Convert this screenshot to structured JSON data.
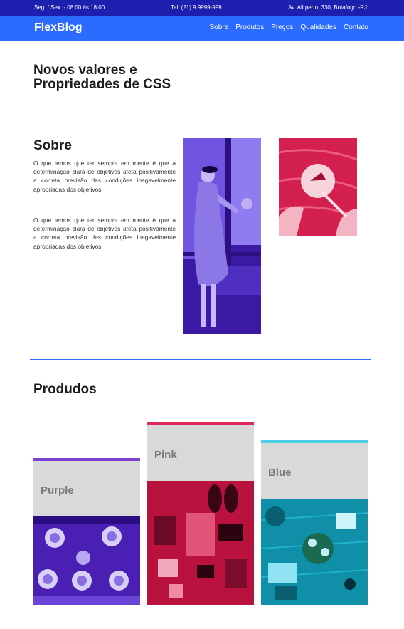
{
  "topbar": {
    "hours": "Seg. / Sex. - 08:00 às 18:00",
    "phone": "Tel: (21) 9 9999-999",
    "address": "Av. Ali perto, 330, Botafogo -RJ"
  },
  "nav": {
    "logo": "FlexBlog",
    "items": [
      "Sobre",
      "Produtos",
      "Preços",
      "Qualidades",
      "Contato"
    ]
  },
  "page": {
    "title": "Novos valores e Propriedades de CSS"
  },
  "sobre": {
    "title": "Sobre",
    "paragraphs": [
      "O que temos que ter sempre em mente é que a determinação clara de objetivos afeta positivamente a correta previsão das condições inegavelmente apropriadas dos objetivos",
      "O que temos que ter sempre em mente é que a determinação clara de objetivos afeta positivamente a correta previsão das condições inegavelmente apropriadas dos objetivos"
    ]
  },
  "produtos": {
    "title": "Produdos",
    "cards": [
      {
        "label": "Purple",
        "accent": "#7b3fd1"
      },
      {
        "label": "Pink",
        "accent": "#e0285a"
      },
      {
        "label": "Blue",
        "accent": "#4fd0e8"
      }
    ]
  },
  "colors": {
    "topbar": "#1d1fae",
    "navbar": "#2b6cff"
  }
}
